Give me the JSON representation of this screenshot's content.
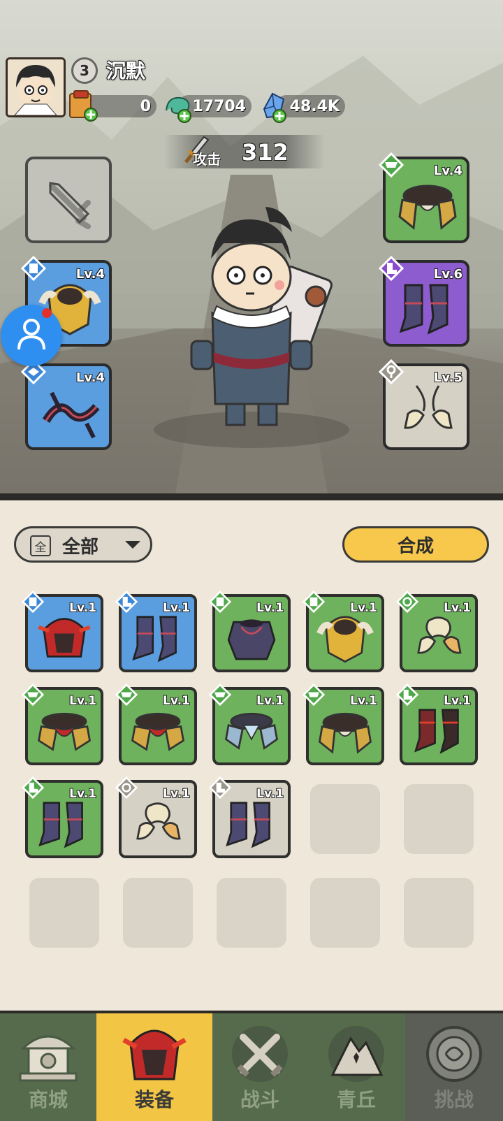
{
  "player": {
    "name": "沉默",
    "level": "3"
  },
  "resources": [
    {
      "name": "scroll",
      "value": "0"
    },
    {
      "name": "jade",
      "value": "17704"
    },
    {
      "name": "crystal",
      "value": "48.4K"
    }
  ],
  "attack": {
    "label": "攻击",
    "value": "312"
  },
  "equipped": {
    "left": [
      {
        "slot": "weapon",
        "empty": true
      },
      {
        "slot": "helmet",
        "rarity": "blue",
        "level": "Lv.4"
      },
      {
        "slot": "belt",
        "rarity": "blue",
        "level": "Lv.4"
      }
    ],
    "right": [
      {
        "slot": "shoulder",
        "rarity": "green",
        "level": "Lv.4"
      },
      {
        "slot": "boots",
        "rarity": "purple",
        "level": "Lv.6"
      },
      {
        "slot": "charm",
        "rarity": "gray",
        "level": "Lv.5"
      }
    ]
  },
  "filter": {
    "icon_text": "全",
    "label": "全部"
  },
  "synthesize": {
    "label": "合成"
  },
  "inventory": [
    {
      "rarity": "blue",
      "level": "Lv.1",
      "item": "red-helmet"
    },
    {
      "rarity": "blue",
      "level": "Lv.1",
      "item": "purple-boots"
    },
    {
      "rarity": "green",
      "level": "Lv.1",
      "item": "dark-armor"
    },
    {
      "rarity": "green",
      "level": "Lv.1",
      "item": "gold-helmet"
    },
    {
      "rarity": "green",
      "level": "Lv.1",
      "item": "bone-charm"
    },
    {
      "rarity": "green",
      "level": "Lv.1",
      "item": "red-shoulder"
    },
    {
      "rarity": "green",
      "level": "Lv.1",
      "item": "red-shoulder"
    },
    {
      "rarity": "green",
      "level": "Lv.1",
      "item": "ice-shoulder"
    },
    {
      "rarity": "green",
      "level": "Lv.1",
      "item": "gold-shoulder"
    },
    {
      "rarity": "green",
      "level": "Lv.1",
      "item": "red-boots"
    },
    {
      "rarity": "green",
      "level": "Lv.1",
      "item": "purple-boots"
    },
    {
      "rarity": "gray",
      "level": "Lv.1",
      "item": "bone-charm"
    },
    {
      "rarity": "gray",
      "level": "Lv.1",
      "item": "purple-boots"
    }
  ],
  "nav": [
    {
      "label": "商城",
      "icon": "shop-icon",
      "state": "normal"
    },
    {
      "label": "装备",
      "icon": "equipment-icon",
      "state": "active"
    },
    {
      "label": "战斗",
      "icon": "battle-icon",
      "state": "normal"
    },
    {
      "label": "青丘",
      "icon": "mountain-icon",
      "state": "normal"
    },
    {
      "label": "挑战",
      "icon": "challenge-icon",
      "state": "locked"
    }
  ],
  "colors": {
    "blue": "#5b9ee0",
    "green": "#6fb25e",
    "purple": "#8d5ccf",
    "gray": "#d6d1c5",
    "accent_yellow": "#f7c84b",
    "nav_bg": "#566a4c"
  }
}
